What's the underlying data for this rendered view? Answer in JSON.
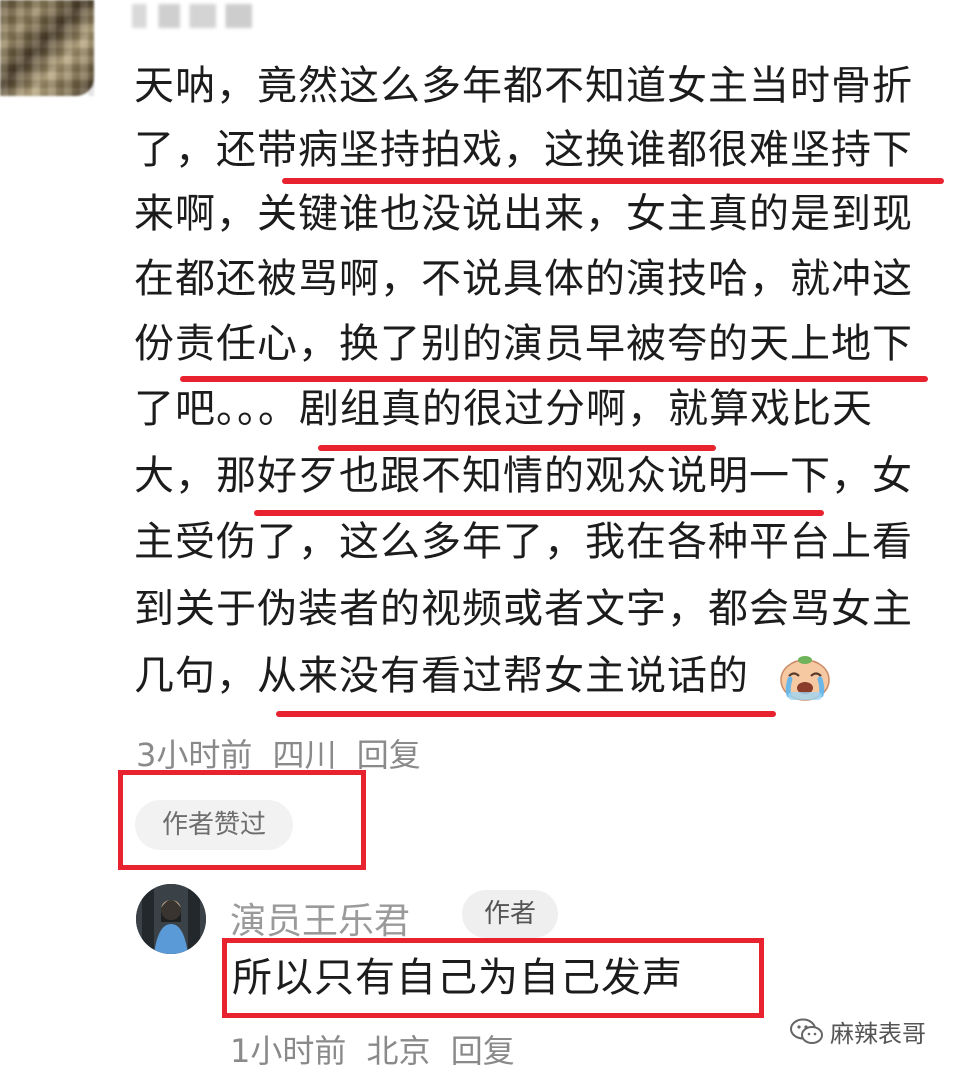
{
  "comment": {
    "username": "",
    "lines": [
      "天呐，竟然这么多年都不知道女主当时骨折",
      "了，还带病坚持拍戏，这换谁都很难坚持下",
      "来啊，关键谁也没说出来，女主真的是到现",
      "在都还被骂啊，不说具体的演技哈，就冲这",
      "份责任心，换了别的演员早被夸的天上地下",
      "了吧。。。剧组真的很过分啊，就算戏比天",
      "大，那好歹也跟不知情的观众说明一下，女",
      "主受伤了，这么多年了，我在各种平台上看",
      "到关于伪装者的视频或者文字，都会骂女主",
      "几句，从来没有看过帮女主说话的"
    ],
    "emoji": "crying-face-emoji",
    "time": "3小时前",
    "location": "四川",
    "reply_label": "回复",
    "author_liked_chip": "作者赞过"
  },
  "reply": {
    "name": "演员王乐君",
    "author_tag": "作者",
    "text": "所以只有自己为自己发声",
    "time": "1小时前",
    "location": "北京",
    "reply_label": "回复"
  },
  "watermark": {
    "icon": "wechat-icon",
    "text": "麻辣表哥"
  },
  "colors": {
    "highlight_red": "#e8232f",
    "meta_gray": "#8a8a8a",
    "chip_bg": "#f2f2f2"
  }
}
